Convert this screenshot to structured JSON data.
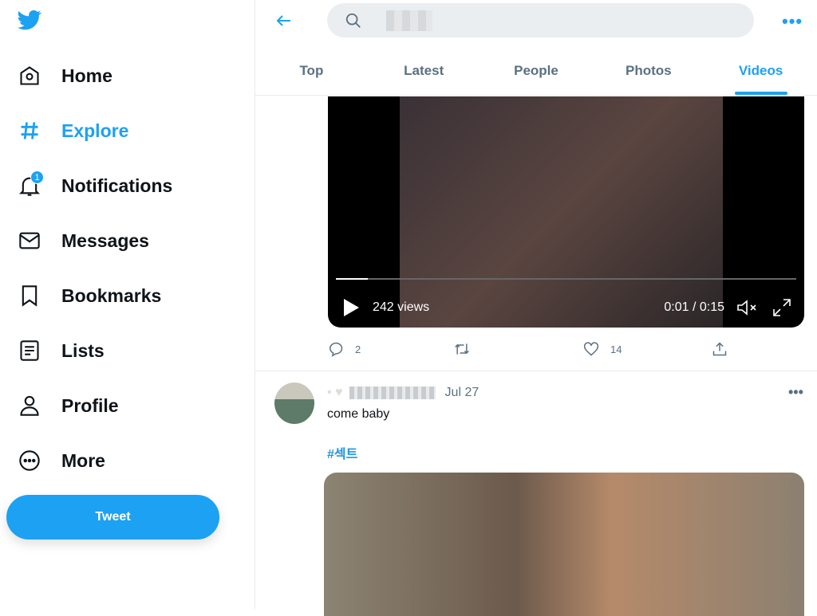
{
  "sidebar": {
    "items": [
      {
        "label": "Home",
        "icon": "home-icon"
      },
      {
        "label": "Explore",
        "icon": "hashtag-icon",
        "active": true
      },
      {
        "label": "Notifications",
        "icon": "bell-icon",
        "badge": "1"
      },
      {
        "label": "Messages",
        "icon": "envelope-icon"
      },
      {
        "label": "Bookmarks",
        "icon": "bookmark-icon"
      },
      {
        "label": "Lists",
        "icon": "list-icon"
      },
      {
        "label": "Profile",
        "icon": "person-icon"
      },
      {
        "label": "More",
        "icon": "more-circle-icon"
      }
    ],
    "tweet_label": "Tweet"
  },
  "header": {
    "more": "•••"
  },
  "tabs": [
    "Top",
    "Latest",
    "People",
    "Photos",
    "Videos"
  ],
  "active_tab": "Videos",
  "tweet1": {
    "video": {
      "views": "242 views",
      "time": "0:01 / 0:15",
      "progress": 0.07
    },
    "replies": "2",
    "likes": "14"
  },
  "tweet2": {
    "date": "Jul 27",
    "text": "come baby",
    "hashtag": "#섹트",
    "more": "•••"
  },
  "colors": {
    "accent": "#1da1f2"
  }
}
